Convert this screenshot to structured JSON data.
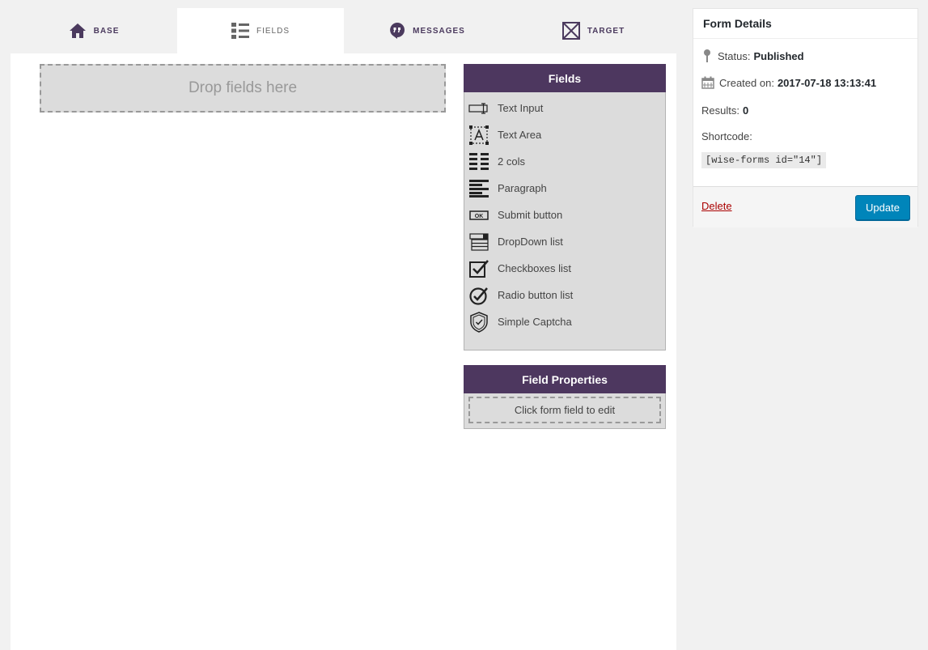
{
  "tabs": [
    {
      "label": "BASE",
      "icon": "home-icon"
    },
    {
      "label": "FIELDS",
      "icon": "list-icon"
    },
    {
      "label": "MESSAGES",
      "icon": "chat-bubble-icon"
    },
    {
      "label": "TARGET",
      "icon": "envelope-icon"
    }
  ],
  "active_tab": "FIELDS",
  "dropzone": {
    "text": "Drop fields here"
  },
  "fields_panel": {
    "title": "Fields",
    "items": [
      {
        "label": "Text Input",
        "icon": "text-input-icon"
      },
      {
        "label": "Text Area",
        "icon": "text-area-icon"
      },
      {
        "label": "2 cols",
        "icon": "two-columns-icon"
      },
      {
        "label": "Paragraph",
        "icon": "paragraph-icon"
      },
      {
        "label": "Submit button",
        "icon": "submit-button-icon"
      },
      {
        "label": "DropDown list",
        "icon": "dropdown-list-icon"
      },
      {
        "label": "Checkboxes list",
        "icon": "checkbox-icon"
      },
      {
        "label": "Radio button list",
        "icon": "radio-button-icon"
      },
      {
        "label": "Simple Captcha",
        "icon": "shield-icon"
      }
    ]
  },
  "field_properties": {
    "title": "Field Properties",
    "placeholder": "Click form field to edit"
  },
  "form_details": {
    "title": "Form Details",
    "status_label": "Status:",
    "status_value": "Published",
    "created_label": "Created on:",
    "created_value": "2017-07-18 13:13:41",
    "results_label": "Results:",
    "results_value": "0",
    "shortcode_label": "Shortcode:",
    "shortcode_value": "[wise-forms id=\"14\"]",
    "delete_label": "Delete",
    "update_label": "Update"
  },
  "colors": {
    "accent": "#4d375f",
    "primary_button": "#0085ba",
    "delete_link": "#aa0000"
  }
}
